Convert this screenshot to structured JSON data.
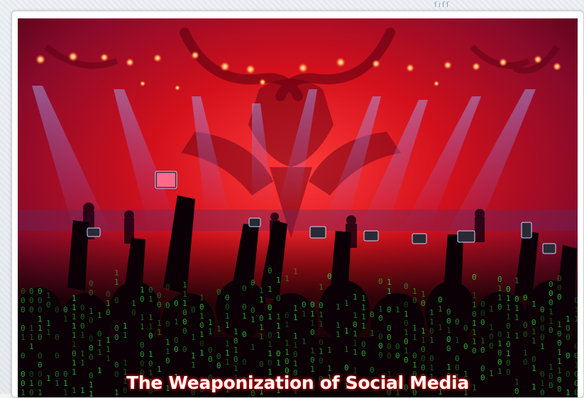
{
  "article": {
    "image_caption": "The Weaponization of Social Media",
    "image_subject": "concert crowd holding phones under a demonic horned figure with green matrix code",
    "corner_mark_text": "ſıſſ"
  },
  "colors": {
    "page_background": "#eef1f4",
    "card_background": "#ffffff",
    "card_border": "#c9ccd1",
    "stage_red": "#d4101c",
    "spotlight_blue": "#6a6cff",
    "code_green": "#39ff4a",
    "caption_glow": "#ff1010"
  }
}
